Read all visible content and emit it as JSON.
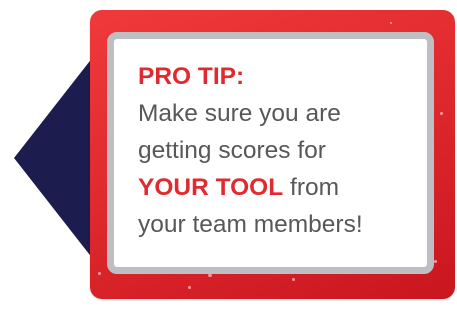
{
  "colors": {
    "accent_red": "#e02a2e",
    "arrow_navy": "#1c1c4e",
    "frame_gray": "#bdbfc3",
    "body_text": "#58585b"
  },
  "icons": [
    "left-arrow-icon"
  ],
  "tip": {
    "heading": "PRO TIP:",
    "line_1": "Make sure you are",
    "line_2": "getting scores for",
    "emphasis": "YOUR TOOL",
    "line_3_rest": " from",
    "line_4": "your team members!"
  }
}
